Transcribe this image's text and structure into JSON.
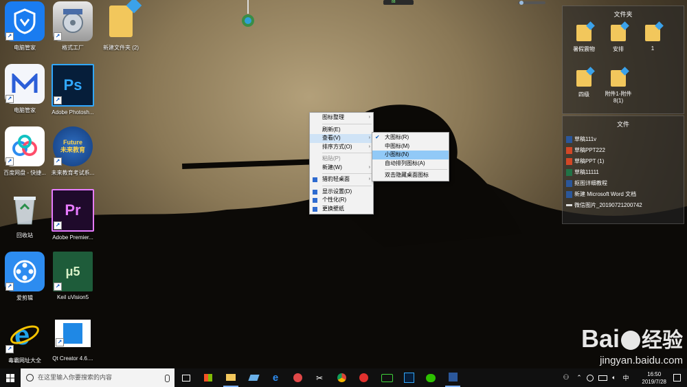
{
  "desktop_icons": [
    {
      "label": "电脑管家"
    },
    {
      "label": "格式工厂"
    },
    {
      "label": "新建文件夹 (2)"
    },
    {
      "label": "电脑管家"
    },
    {
      "label": "Adobe Photosh..."
    },
    {
      "label": "百度网盘 - 快捷..."
    },
    {
      "label": "未来教育考试系..."
    },
    {
      "label": "回收站"
    },
    {
      "label": "Adobe Premier..."
    },
    {
      "label": "爱剪辑"
    },
    {
      "label": "Keil uVision5"
    },
    {
      "label": "毒霸网址大全"
    },
    {
      "label": "Qt Creator 4.6...."
    }
  ],
  "tile_text": {
    "ps": "Ps",
    "pr": "Pr",
    "future": "Future\n未来教育",
    "keil": "μ5"
  },
  "context_menu": {
    "items": [
      {
        "label": "图标整理",
        "submenu": true
      },
      {
        "label": "刷新(E)"
      },
      {
        "label": "查看(V)",
        "submenu": true
      },
      {
        "label": "排序方式(O)",
        "submenu": true
      },
      {
        "label": "粘贴(P)",
        "disabled": true
      },
      {
        "label": "新建(W)",
        "submenu": true
      },
      {
        "label": "猎豹轻桌面",
        "submenu": true
      },
      {
        "label": "显示设置(D)"
      },
      {
        "label": "个性化(R)"
      },
      {
        "label": "更换壁纸"
      }
    ]
  },
  "view_submenu": {
    "items": [
      {
        "label": "大图标(R)",
        "checked": true
      },
      {
        "label": "中图标(M)"
      },
      {
        "label": "小图标(N)",
        "highlighted": true
      },
      {
        "label": "自动排列图标(A)"
      },
      {
        "label": "双击隐藏桌面图标"
      }
    ]
  },
  "fence_folders": {
    "title": "文件夹",
    "items": [
      "暑假震物",
      "安排",
      "1",
      "四级",
      "附件1-附件8(1)"
    ]
  },
  "fence_files": {
    "title": "文件",
    "items": [
      "草稿111v",
      "草稿PPT222",
      "草稿PPT (1)",
      "草稿11111",
      "抠图详细教程",
      "新建 Microsoft Word 文档",
      "微信图片_20190721200742"
    ]
  },
  "taskbar": {
    "search_placeholder": "在这里输入你要搜索的内容",
    "ime": "中",
    "time": "16:50",
    "date": "2019/7/28",
    "top_widget_text": "88"
  },
  "watermark": {
    "brand": "Bai",
    "brand2": "经验",
    "url": "jingyan.baidu.com"
  }
}
